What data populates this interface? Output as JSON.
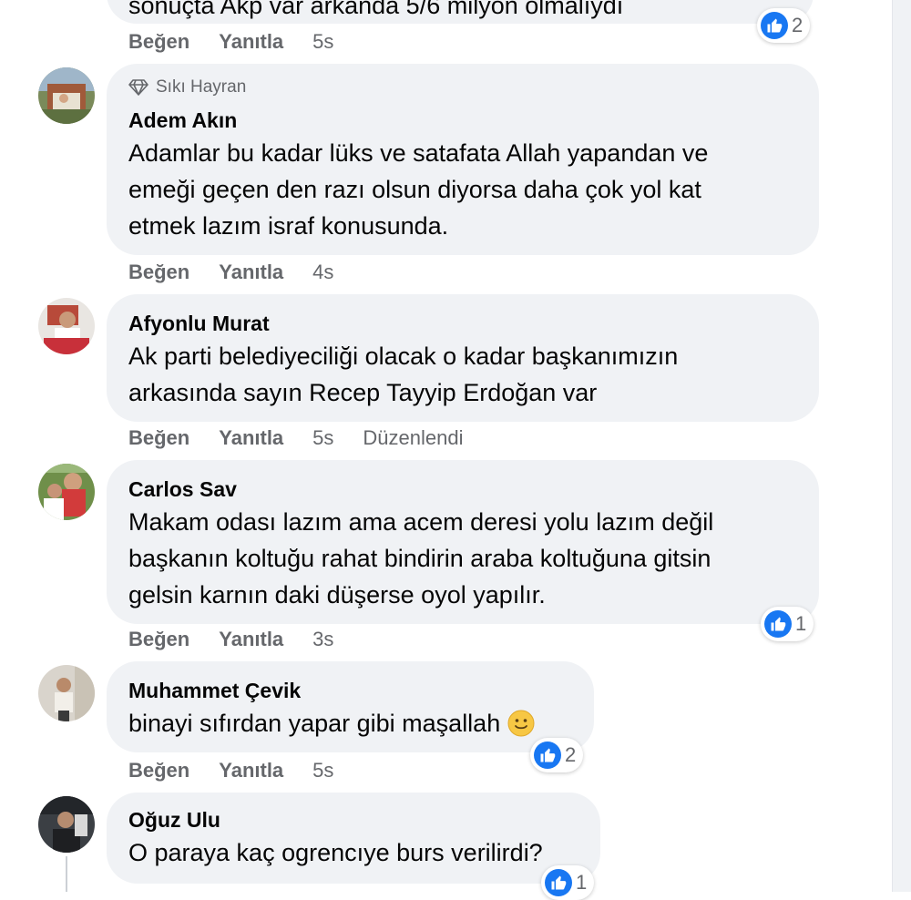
{
  "colors": {
    "like": "#1877f2",
    "bubble": "#f0f2f5",
    "meta": "#65676b"
  },
  "top": {
    "text": "sonuçta Akp var arkanda 5/6 milyon olmalıydı",
    "like": "Beğen",
    "reply": "Yanıtla",
    "time": "5s",
    "reaction_count": "2"
  },
  "comments": [
    {
      "badge": "Sıkı Hayran",
      "author": "Adem Akın",
      "lines": [
        "Adamlar bu kadar lüks ve satafata Allah yapandan ve",
        "emeği geçen den razı olsun diyorsa daha çok yol kat",
        "etmek lazım israf konusunda."
      ],
      "like": "Beğen",
      "reply": "Yanıtla",
      "time": "4s"
    },
    {
      "author": "Afyonlu Murat",
      "lines": [
        "Ak parti belediyeciliği olacak o kadar başkanımızın",
        "arkasında sayın Recep Tayyip Erdoğan var"
      ],
      "like": "Beğen",
      "reply": "Yanıtla",
      "time": "5s",
      "edited": "Düzenlendi"
    },
    {
      "author": "Carlos Sav",
      "lines": [
        "Makam odası lazım ama acem deresi yolu lazım değil",
        "başkanın koltuğu rahat bindirin araba koltuğuna gitsin",
        "gelsin karnın daki düşerse oyol yapılır."
      ],
      "like": "Beğen",
      "reply": "Yanıtla",
      "time": "3s",
      "reaction_count": "1"
    },
    {
      "author": "Muhammet Çevik",
      "lines": [
        "binayi sıfırdan yapar gibi maşallah"
      ],
      "emoji": "🙂",
      "like": "Beğen",
      "reply": "Yanıtla",
      "time": "5s",
      "reaction_count": "2"
    },
    {
      "author": "Oğuz Ulu",
      "lines": [
        "O paraya kaç ogrencıye burs verilirdi?"
      ],
      "reaction_count": "1"
    }
  ]
}
